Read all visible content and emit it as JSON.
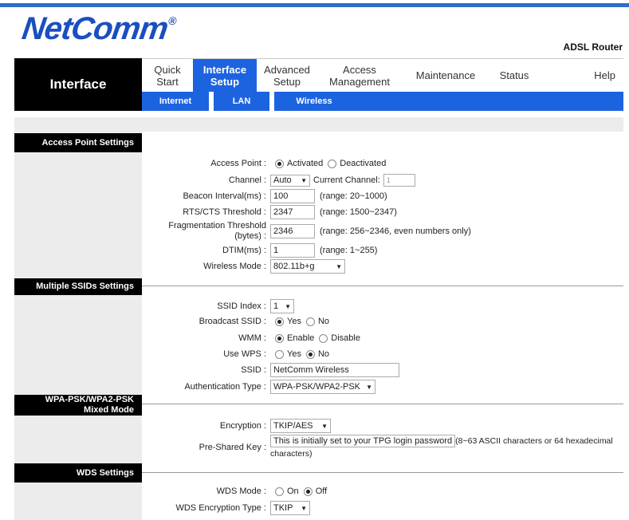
{
  "header": {
    "logo_text": "NetComm",
    "logo_mark": "®",
    "product": "ADSL Router"
  },
  "page_section": "Interface",
  "nav": [
    {
      "label": "Quick\nStart",
      "active": false
    },
    {
      "label": "Interface\nSetup",
      "active": true
    },
    {
      "label": "Advanced\nSetup",
      "active": false
    },
    {
      "label": "Access\nManagement",
      "active": false
    },
    {
      "label": "Maintenance",
      "active": false
    },
    {
      "label": "Status",
      "active": false
    },
    {
      "label": "Help",
      "active": false
    }
  ],
  "subnav": [
    "Internet",
    "LAN",
    "Wireless"
  ],
  "sections": {
    "ap": "Access Point Settings",
    "ssid": "Multiple SSIDs Settings",
    "wpa": "WPA-PSK/WPA2-PSK Mixed Mode",
    "wds": "WDS Settings"
  },
  "ap": {
    "access_point_label": "Access Point :",
    "activated": "Activated",
    "deactivated": "Deactivated",
    "channel_label": "Channel :",
    "channel_value": "Auto",
    "current_channel_label": "Current Channel:",
    "current_channel_value": "1",
    "beacon_label": "Beacon Interval(ms) :",
    "beacon_value": "100",
    "beacon_range": "(range: 20~1000)",
    "rts_label": "RTS/CTS Threshold :",
    "rts_value": "2347",
    "rts_range": "(range: 1500~2347)",
    "frag_label": "Fragmentation Threshold (bytes) :",
    "frag_value": "2346",
    "frag_range": "(range: 256~2346, even numbers only)",
    "dtim_label": "DTIM(ms) :",
    "dtim_value": "1",
    "dtim_range": "(range: 1~255)",
    "mode_label": "Wireless Mode :",
    "mode_value": "802.11b+g"
  },
  "ssid": {
    "index_label": "SSID Index :",
    "index_value": "1",
    "broadcast_label": "Broadcast SSID :",
    "yes": "Yes",
    "no": "No",
    "wmm_label": "WMM :",
    "enable": "Enable",
    "disable": "Disable",
    "wps_label": "Use WPS :",
    "ssid_label": "SSID :",
    "ssid_value": "NetComm Wireless",
    "auth_label": "Authentication Type :",
    "auth_value": "WPA-PSK/WPA2-PSK"
  },
  "wpa": {
    "enc_label": "Encryption :",
    "enc_value": "TKIP/AES",
    "psk_label": "Pre-Shared Key :",
    "psk_value": "This is initially set to your TPG login password",
    "psk_hint": "(8~63 ASCII characters or 64 hexadecimal characters)"
  },
  "wds": {
    "mode_label": "WDS Mode :",
    "on": "On",
    "off": "Off",
    "enc_label": "WDS Encryption Type :",
    "enc_value": "TKIP"
  }
}
